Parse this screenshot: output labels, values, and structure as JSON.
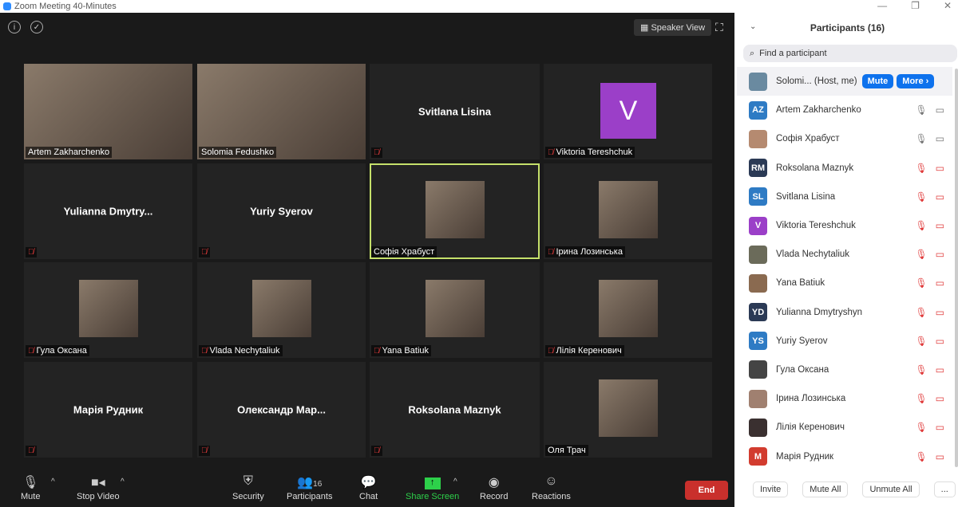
{
  "window": {
    "title": "Zoom Meeting 40-Minutes"
  },
  "stage": {
    "speaker_view": "Speaker View"
  },
  "tiles": [
    {
      "name": "Artem Zakharchenko",
      "video": true,
      "muted": false
    },
    {
      "name": "Solomia Fedushko",
      "video": true,
      "muted": false
    },
    {
      "name": "Svitlana Lisina",
      "video": false,
      "muted": true
    },
    {
      "name": "Viktoria Tereshchuk",
      "video": false,
      "muted": true,
      "initial": "V"
    },
    {
      "name": "Yulianna  Dmytry...",
      "video": false,
      "muted": true
    },
    {
      "name": "Yuriy Syerov",
      "video": false,
      "muted": true
    },
    {
      "name": "Софія Храбуст",
      "video": true,
      "muted": false,
      "active": true
    },
    {
      "name": "Ірина Лозинська",
      "video": true,
      "muted": true
    },
    {
      "name": "Гула Оксана",
      "video": true,
      "muted": true
    },
    {
      "name": "Vlada Nechytaliuk",
      "video": true,
      "muted": true
    },
    {
      "name": "Yana Batiuk",
      "video": true,
      "muted": true
    },
    {
      "name": "Лілія Керенович",
      "video": true,
      "muted": true
    },
    {
      "name": "Марія Рудник",
      "video": false,
      "muted": true
    },
    {
      "name": "Олександр  Мар...",
      "video": false,
      "muted": true
    },
    {
      "name": "Roksolana Maznyk",
      "video": false,
      "muted": true
    },
    {
      "name": "Оля Трач",
      "video": true,
      "muted": false
    }
  ],
  "toolbar": {
    "mute": "Mute",
    "stop_video": "Stop Video",
    "security": "Security",
    "participants": "Participants",
    "participants_count": "16",
    "chat": "Chat",
    "share_screen": "Share Screen",
    "record": "Record",
    "reactions": "Reactions",
    "end": "End"
  },
  "panel": {
    "title": "Participants (16)",
    "search_placeholder": "Find a participant",
    "host": {
      "name": "Solomi... (Host, me)",
      "mute": "Mute",
      "more": "More ›"
    },
    "participants": [
      {
        "name": "Artem Zakharchenko",
        "initials": "AZ",
        "color": "#2e7bc4",
        "muted": false
      },
      {
        "name": "Софія Храбуст",
        "initials": "",
        "color": "#b58a70",
        "muted": false
      },
      {
        "name": "Roksolana Maznyk",
        "initials": "RM",
        "color": "#2b3a55",
        "muted": true
      },
      {
        "name": "Svitlana Lisina",
        "initials": "SL",
        "color": "#2e7bc4",
        "muted": true
      },
      {
        "name": "Viktoria Tereshchuk",
        "initials": "V",
        "color": "#9b3fc8",
        "muted": true
      },
      {
        "name": "Vlada Nechytaliuk",
        "initials": "",
        "color": "#6b6b5a",
        "muted": true
      },
      {
        "name": "Yana Batiuk",
        "initials": "",
        "color": "#8a6a50",
        "muted": true
      },
      {
        "name": "Yulianna Dmytryshyn",
        "initials": "YD",
        "color": "#2b3a55",
        "muted": true
      },
      {
        "name": "Yuriy Syerov",
        "initials": "YS",
        "color": "#2e7bc4",
        "muted": true
      },
      {
        "name": "Гула Оксана",
        "initials": "",
        "color": "#444",
        "muted": true
      },
      {
        "name": "Ірина Лозинська",
        "initials": "",
        "color": "#a08070",
        "muted": true
      },
      {
        "name": "Лілія Керенович",
        "initials": "",
        "color": "#3a3030",
        "muted": true
      },
      {
        "name": "Марія Рудник",
        "initials": "M",
        "color": "#d23c2f",
        "muted": true
      }
    ],
    "invite": "Invite",
    "mute_all": "Mute All",
    "unmute_all": "Unmute All",
    "more": "..."
  }
}
